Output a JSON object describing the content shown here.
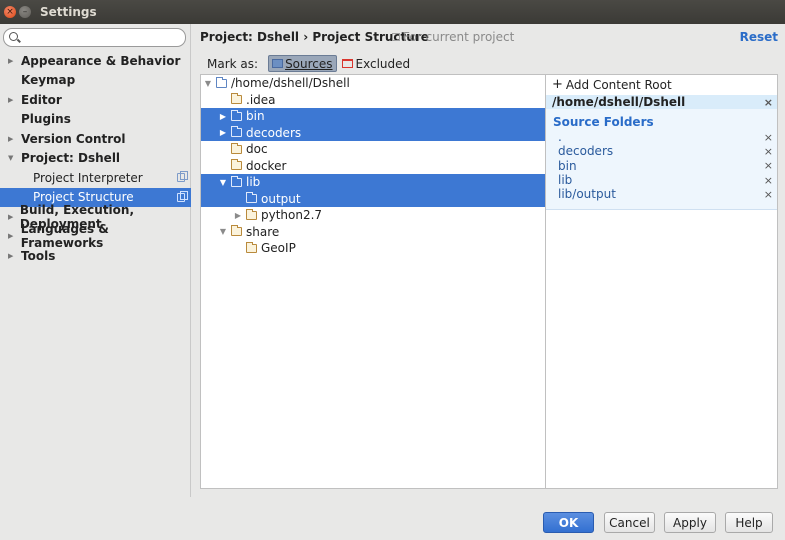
{
  "window": {
    "title": "Settings"
  },
  "search": {
    "value": "",
    "placeholder": ""
  },
  "sidebar": {
    "items": [
      {
        "label": "Appearance & Behavior",
        "arrow": "▶",
        "sub": false,
        "selected": false
      },
      {
        "label": "Keymap",
        "arrow": "",
        "sub": false,
        "selected": false
      },
      {
        "label": "Editor",
        "arrow": "▶",
        "sub": false,
        "selected": false
      },
      {
        "label": "Plugins",
        "arrow": "",
        "sub": false,
        "selected": false
      },
      {
        "label": "Version Control",
        "arrow": "▶",
        "sub": false,
        "selected": false
      },
      {
        "label": "Project: Dshell",
        "arrow": "▼",
        "sub": false,
        "selected": false
      },
      {
        "label": "Project Interpreter",
        "arrow": "",
        "sub": true,
        "selected": false
      },
      {
        "label": "Project Structure",
        "arrow": "",
        "sub": true,
        "selected": true
      },
      {
        "label": "Build, Execution, Deployment",
        "arrow": "▶",
        "sub": false,
        "selected": false
      },
      {
        "label": "Languages & Frameworks",
        "arrow": "▶",
        "sub": false,
        "selected": false
      },
      {
        "label": "Tools",
        "arrow": "▶",
        "sub": false,
        "selected": false
      }
    ]
  },
  "header": {
    "breadcrumb": "Project: Dshell › Project Structure",
    "scope_note": "For current project",
    "reset_label": "Reset"
  },
  "markas": {
    "label": "Mark as:",
    "sources_label": "Sources",
    "excluded_label": "Excluded"
  },
  "tree": {
    "rows": [
      {
        "label": "/home/dshell/Dshell",
        "arrow": "▼",
        "indent": 0,
        "selected": false,
        "kind": "root"
      },
      {
        "label": ".idea",
        "arrow": "",
        "indent": 1,
        "selected": false,
        "kind": "plain"
      },
      {
        "label": "bin",
        "arrow": "▶",
        "indent": 1,
        "selected": true,
        "kind": "src"
      },
      {
        "label": "decoders",
        "arrow": "▶",
        "indent": 1,
        "selected": true,
        "kind": "src"
      },
      {
        "label": "doc",
        "arrow": "",
        "indent": 1,
        "selected": false,
        "kind": "plain"
      },
      {
        "label": "docker",
        "arrow": "",
        "indent": 1,
        "selected": false,
        "kind": "plain"
      },
      {
        "label": "lib",
        "arrow": "▼",
        "indent": 1,
        "selected": true,
        "kind": "src"
      },
      {
        "label": "output",
        "arrow": "",
        "indent": 2,
        "selected": true,
        "kind": "src"
      },
      {
        "label": "python2.7",
        "arrow": "▶",
        "indent": 2,
        "selected": false,
        "kind": "plain"
      },
      {
        "label": "share",
        "arrow": "▼",
        "indent": 1,
        "selected": false,
        "kind": "plain"
      },
      {
        "label": "GeoIP",
        "arrow": "",
        "indent": 2,
        "selected": false,
        "kind": "plain"
      }
    ]
  },
  "content_root": {
    "add_label": "Add Content Root",
    "path": "/home/dshell/Dshell",
    "remove_glyph": "×",
    "source_folders_title": "Source Folders",
    "source_folders": [
      ".",
      "decoders",
      "bin",
      "lib",
      "lib/output"
    ]
  },
  "buttons": {
    "ok": "OK",
    "cancel": "Cancel",
    "apply": "Apply",
    "help": "Help"
  },
  "colors": {
    "selection": "#3d78d3",
    "link": "#2a6cc8",
    "source_folder": "#5f86c3",
    "excluded_folder": "#d9362f"
  }
}
